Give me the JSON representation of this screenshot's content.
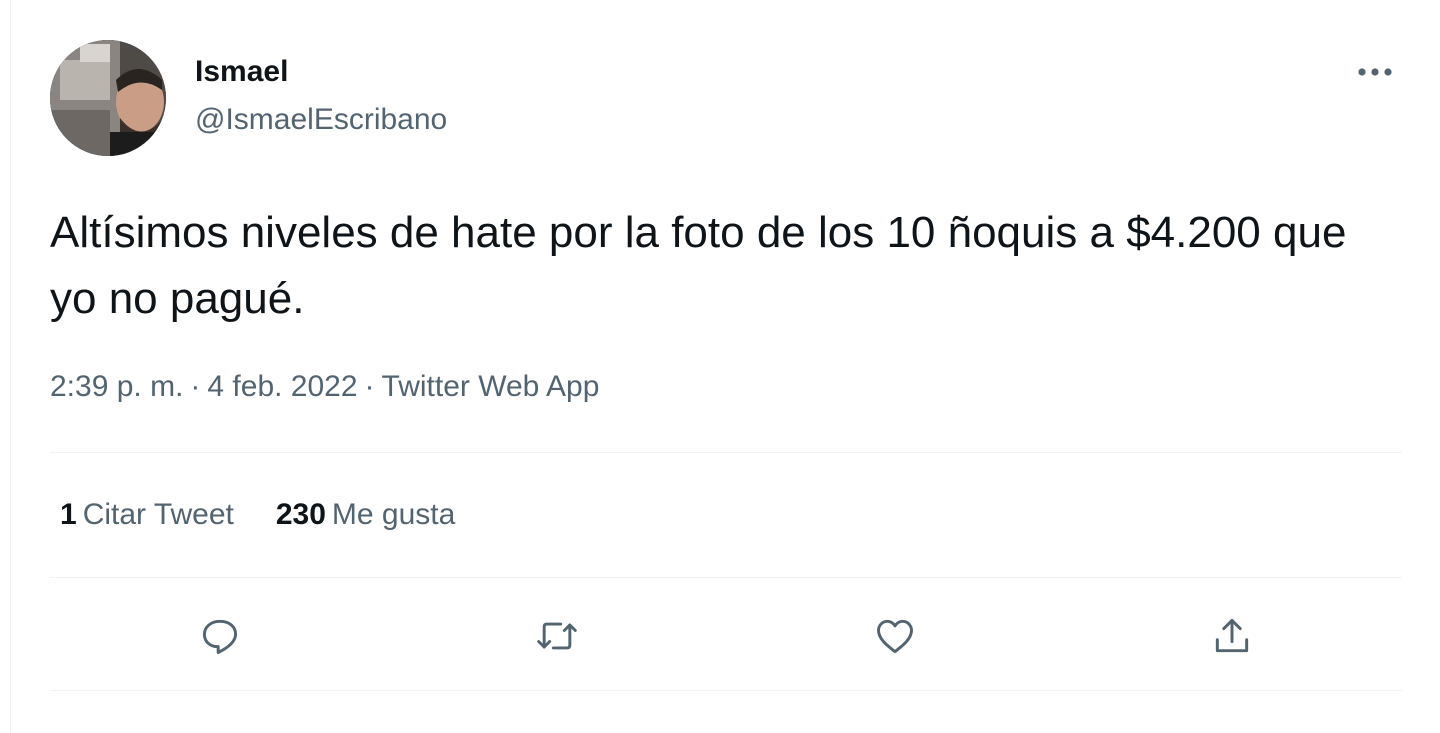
{
  "user": {
    "name": "Ismael",
    "handle": "@IsmaelEscribano"
  },
  "tweet": {
    "text": "Altísimos niveles de hate por la foto de los 10 ñoquis a $4.200 que yo no pagué.",
    "time": "2:39 p. m.",
    "separator": "·",
    "date": "4 feb. 2022",
    "source": "Twitter Web App"
  },
  "stats": {
    "quotes_count": "1",
    "quotes_label": "Citar Tweet",
    "likes_count": "230",
    "likes_label": "Me gusta"
  },
  "icons": {
    "more": "more-horizontal-icon",
    "reply": "reply-icon",
    "retweet": "retweet-icon",
    "like": "heart-icon",
    "share": "share-icon"
  },
  "colors": {
    "text": "#0f1419",
    "secondary": "#536471",
    "divider": "#eff3f4"
  }
}
